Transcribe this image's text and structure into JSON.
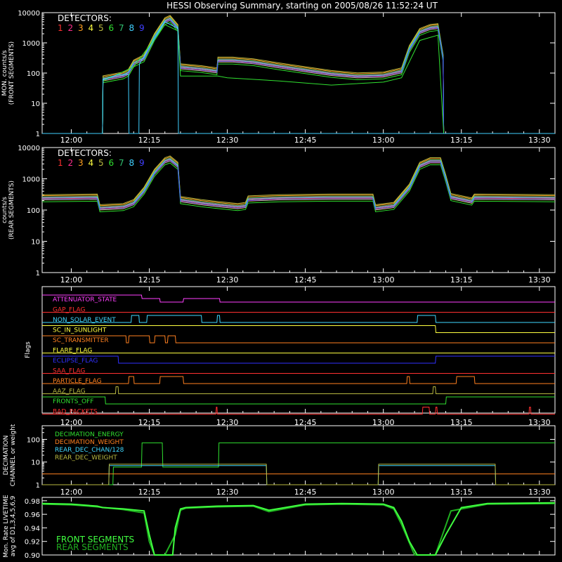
{
  "title": "HESSI Observing Summary, starting on 2005/08/26 11:52:24 UT",
  "colors": {
    "background": "#000000",
    "axes": "#ffffff",
    "detectors": [
      "#ff3030",
      "#ff2d8c",
      "#ffa020",
      "#ffff40",
      "#b8b840",
      "#30e030",
      "#30c070",
      "#40d0ff",
      "#4040ff"
    ]
  },
  "time_axis": {
    "start_minutes": 714.4,
    "end_minutes": 813.0,
    "ticks": [
      {
        "t": 720,
        "label": "12:00"
      },
      {
        "t": 735,
        "label": "12:15"
      },
      {
        "t": 750,
        "label": "12:30"
      },
      {
        "t": 765,
        "label": "12:45"
      },
      {
        "t": 780,
        "label": "13:00"
      },
      {
        "t": 795,
        "label": "13:15"
      },
      {
        "t": 810,
        "label": "13:30"
      }
    ]
  },
  "chart_data": [
    {
      "type": "line",
      "id": "front",
      "ylabel": "MON. counts/s\n(FRONT SEGMENTS)",
      "ylog": true,
      "ylim": [
        1,
        10000
      ],
      "yticks": [
        {
          "v": 1,
          "label": "1"
        },
        {
          "v": 10,
          "label": "10"
        },
        {
          "v": 100,
          "label": "100"
        },
        {
          "v": 1000,
          "label": "1000"
        },
        {
          "v": 10000,
          "label": "10000"
        }
      ],
      "legend_title": "DETECTORS:",
      "legend_labels": [
        "1",
        "2",
        "3",
        "4",
        "5",
        "6",
        "7",
        "8",
        "9"
      ],
      "series": [
        {
          "name": "detectors",
          "x": [
            714.4,
            726.0,
            726.1,
            730.0,
            731.0,
            732.0,
            734.0,
            736.0,
            738.0,
            739.0,
            740.5,
            741.0,
            745.0,
            748.0,
            748.2,
            751.0,
            755.0,
            760.0,
            765.0,
            770.0,
            775.0,
            780.0,
            783.5,
            785.0,
            787.0,
            789.0,
            790.5,
            791.5,
            791.6,
            813.0
          ],
          "y": [
            1,
            1,
            60,
            80,
            100,
            200,
            300,
            1500,
            5000,
            6000,
            3000,
            150,
            130,
            110,
            250,
            250,
            220,
            160,
            120,
            90,
            75,
            80,
            110,
            600,
            2200,
            3000,
            3200,
            300,
            1,
            1
          ]
        },
        {
          "name": "detector 6",
          "x": [
            714.4,
            726.0,
            726.1,
            732.0,
            738.0,
            740.5,
            741.0,
            748.2,
            750.0,
            760.0,
            770.0,
            780.0,
            783.5,
            787.0,
            790.5,
            791.6,
            813.0
          ],
          "y": [
            1,
            1,
            55,
            160,
            4000,
            2500,
            80,
            80,
            70,
            55,
            40,
            50,
            70,
            1200,
            1800,
            1,
            1
          ]
        },
        {
          "name": "detector 8",
          "x": [
            714.4,
            726.0,
            726.1,
            729.0,
            731.0,
            731.1,
            733.0,
            733.1,
            738.0,
            740.5,
            740.6,
            745.0,
            745.1,
            813.0
          ],
          "y": [
            1,
            1,
            60,
            90,
            90,
            1,
            1,
            200,
            5000,
            3000,
            1,
            1,
            1,
            1
          ]
        }
      ]
    },
    {
      "type": "line",
      "id": "rear",
      "ylabel": "counts/s\n(REAR SEGMENTS)",
      "ylog": true,
      "ylim": [
        1,
        10000
      ],
      "yticks": [
        {
          "v": 1,
          "label": "1"
        },
        {
          "v": 10,
          "label": "10"
        },
        {
          "v": 100,
          "label": "100"
        },
        {
          "v": 1000,
          "label": "1000"
        },
        {
          "v": 10000,
          "label": "10000"
        }
      ],
      "legend_title": "DETECTORS:",
      "legend_labels": [
        "1",
        "2",
        "3",
        "4",
        "5",
        "6",
        "7",
        "8",
        "9"
      ],
      "series": [
        {
          "name": "detectors",
          "x": [
            714.4,
            725.0,
            725.5,
            730.0,
            732.0,
            734.0,
            736.0,
            738.0,
            739.0,
            740.5,
            741.0,
            745.0,
            748.0,
            752.0,
            753.5,
            754.0,
            760.0,
            770.0,
            778.0,
            778.5,
            782.0,
            785.0,
            787.0,
            789.0,
            791.0,
            792.0,
            793.0,
            797.0,
            797.5,
            813.0
          ],
          "y": [
            230,
            240,
            110,
            120,
            160,
            400,
            1500,
            3500,
            4000,
            2500,
            200,
            160,
            140,
            120,
            130,
            210,
            230,
            240,
            240,
            110,
            130,
            500,
            2500,
            3500,
            3500,
            1000,
            250,
            180,
            240,
            230
          ]
        }
      ]
    },
    {
      "type": "table",
      "id": "flags",
      "ylabel": "Flags",
      "rows": [
        {
          "label": "ATTENUATOR_STATE",
          "color": "#ff40ff",
          "x": [
            714.4,
            733.5,
            733.6,
            737.0,
            737.1,
            741.5,
            741.6,
            748.5,
            748.6,
            813.0
          ],
          "level": [
            1,
            1,
            0.5,
            0.5,
            0.0,
            0.0,
            0.5,
            0.5,
            0.0,
            0.0
          ]
        },
        {
          "label": "GAP_FLAG",
          "color": "#ff3030",
          "x": [
            714.4,
            813.0
          ],
          "level": [
            0,
            0
          ]
        },
        {
          "label": "NON_SOLAR_EVENT",
          "color": "#40d8ff",
          "x": [
            714.4,
            731.5,
            731.6,
            733.0,
            733.1,
            734.5,
            734.6,
            745.0,
            745.1,
            748.0,
            748.1,
            748.5,
            748.6,
            786.5,
            786.6,
            790.0,
            790.1,
            813.0
          ],
          "level": [
            0,
            0,
            1,
            1,
            0,
            0,
            1,
            1,
            0,
            0,
            1,
            1,
            0,
            0,
            1,
            1,
            0,
            0
          ]
        },
        {
          "label": "SC_IN_SUNLIGHT",
          "color": "#ffff40",
          "x": [
            714.4,
            790.0,
            790.1,
            813.0
          ],
          "level": [
            1,
            1,
            0,
            0
          ]
        },
        {
          "label": "SC_TRANSMITTER",
          "color": "#ff8020",
          "x": [
            714.4,
            730.5,
            730.6,
            731.0,
            731.1,
            735.0,
            735.1,
            736.0,
            736.1,
            738.0,
            738.1,
            738.5,
            738.6,
            740.0,
            740.1,
            747.5,
            747.6,
            813.0
          ],
          "level": [
            1,
            1,
            0,
            0,
            1,
            1,
            0,
            0,
            1,
            1,
            0,
            0,
            1,
            1,
            0,
            0,
            0,
            0
          ]
        },
        {
          "label": "FLARE_FLAG",
          "color": "#ffff40",
          "x": [
            714.4,
            813.0
          ],
          "level": [
            0,
            0
          ]
        },
        {
          "label": "ECLIPSE_FLAG",
          "color": "#3030ff",
          "x": [
            714.4,
            729.0,
            729.1,
            790.0,
            790.1,
            813.0
          ],
          "level": [
            1,
            1,
            0,
            0,
            1,
            1
          ]
        },
        {
          "label": "SAA_FLAG",
          "color": "#ff3030",
          "x": [
            714.4,
            813.0
          ],
          "level": [
            0,
            0
          ]
        },
        {
          "label": "PARTICLE_FLAG",
          "color": "#ff8020",
          "x": [
            714.4,
            731.0,
            731.1,
            732.0,
            732.1,
            737.0,
            737.1,
            741.5,
            741.6,
            784.5,
            784.6,
            785.0,
            785.1,
            794.0,
            794.1,
            797.5,
            797.6,
            798.0,
            798.1,
            813.0
          ],
          "level": [
            0,
            0,
            1,
            1,
            0,
            0,
            1,
            1,
            0,
            0,
            1,
            1,
            0,
            0,
            1,
            1,
            0,
            0,
            0,
            0
          ]
        },
        {
          "label": "AAZ_FLAG",
          "color": "#b8b840",
          "x": [
            714.4,
            728.5,
            728.6,
            729.0,
            729.1,
            789.5,
            789.6,
            790.0,
            790.1,
            813.0
          ],
          "level": [
            0,
            0,
            1,
            1,
            0,
            0,
            1,
            1,
            0,
            0
          ]
        },
        {
          "label": "FRONTS_OFF",
          "color": "#30e030",
          "x": [
            714.4,
            726.5,
            726.6,
            792.0,
            792.1,
            813.0
          ],
          "level": [
            1,
            1,
            0,
            0,
            1,
            1
          ]
        },
        {
          "label": "BAD_PACKETS",
          "color": "#ff3030",
          "x": [
            714.4,
            747.8,
            747.9,
            748.0,
            748.1,
            787.5,
            787.6,
            788.8,
            788.9,
            790.0,
            790.1,
            790.3,
            790.4,
            808.0,
            808.1,
            808.3,
            808.4,
            813.0
          ],
          "level": [
            0,
            0,
            1,
            1,
            0,
            0,
            1,
            1,
            0,
            0,
            1,
            1,
            0,
            0,
            1,
            1,
            0,
            0
          ]
        }
      ]
    },
    {
      "type": "line",
      "id": "decimation",
      "ylabel": "DECIMATION\nCHANNEL or weight",
      "ylog": true,
      "ylim": [
        1,
        400
      ],
      "yticks": [
        {
          "v": 1,
          "label": "1"
        },
        {
          "v": 10,
          "label": "10"
        },
        {
          "v": 100,
          "label": "100"
        }
      ],
      "series": [
        {
          "name": "DECIMATION_ENERGY",
          "color": "#30e030",
          "x": [
            714.4,
            728.0,
            728.1,
            733.5,
            733.6,
            737.5,
            737.6,
            748.3,
            748.4,
            813.0
          ],
          "y": [
            1,
            1,
            6,
            6,
            70,
            70,
            6,
            6,
            70,
            70
          ]
        },
        {
          "name": "DECIMATION_WEIGHT",
          "color": "#ff8020",
          "x": [
            714.4,
            813.0
          ],
          "y": [
            3,
            3
          ]
        },
        {
          "name": "REAR_DEC_CHAN/128",
          "color": "#40d8ff",
          "x": [
            714.4,
            727.2,
            727.3,
            757.5,
            757.6,
            779.0,
            779.1,
            801.5,
            801.6,
            813.0
          ],
          "y": [
            1,
            1,
            7,
            7,
            1,
            1,
            7,
            7,
            1,
            1
          ]
        },
        {
          "name": "REAR_DEC_WEIGHT",
          "color": "#b8b840",
          "x": [
            714.4,
            727.2,
            727.3,
            757.5,
            757.6,
            779.0,
            779.1,
            801.5,
            801.6,
            813.0
          ],
          "y": [
            1,
            1,
            8,
            8,
            1,
            1,
            8,
            8,
            1,
            1
          ]
        }
      ]
    },
    {
      "type": "line",
      "id": "livetime",
      "ylabel": "Mon. Rate LIVETIME\navg of D1,3,4,5,6,9",
      "ylim": [
        0.9,
        0.985
      ],
      "yticks": [
        {
          "v": 0.9,
          "label": "0.90"
        },
        {
          "v": 0.92,
          "label": "0.92"
        },
        {
          "v": 0.94,
          "label": "0.94"
        },
        {
          "v": 0.96,
          "label": "0.96"
        },
        {
          "v": 0.98,
          "label": "0.98"
        }
      ],
      "series": [
        {
          "name": "FRONT SEGMENTS",
          "color": "#40ff40",
          "x": [
            714.4,
            720.0,
            725.0,
            726.0,
            730.0,
            734.0,
            735.0,
            736.0,
            738.0,
            739.5,
            740.0,
            741.0,
            742.0,
            748.0,
            755.0,
            758.0,
            765.0,
            772.0,
            780.0,
            782.0,
            783.5,
            785.0,
            786.5,
            787.0,
            790.0,
            792.0,
            795.0,
            800.0,
            813.0
          ],
          "y": [
            0.976,
            0.975,
            0.972,
            0.97,
            0.968,
            0.965,
            0.93,
            0.9,
            0.9,
            0.9,
            0.94,
            0.968,
            0.97,
            0.972,
            0.973,
            0.966,
            0.975,
            0.976,
            0.975,
            0.97,
            0.95,
            0.92,
            0.9,
            0.9,
            0.9,
            0.93,
            0.97,
            0.976,
            0.977
          ]
        },
        {
          "name": "REAR SEGMENTS",
          "color": "#20b020",
          "x": [
            714.4,
            720.0,
            725.0,
            730.0,
            734.0,
            735.0,
            736.0,
            738.0,
            740.0,
            741.0,
            742.0,
            748.0,
            755.0,
            758.0,
            765.0,
            772.0,
            780.0,
            782.0,
            783.5,
            786.0,
            788.0,
            790.0,
            793.0,
            800.0,
            813.0
          ],
          "y": [
            0.975,
            0.974,
            0.971,
            0.967,
            0.962,
            0.92,
            0.9,
            0.9,
            0.93,
            0.966,
            0.969,
            0.971,
            0.972,
            0.964,
            0.974,
            0.975,
            0.974,
            0.968,
            0.945,
            0.9,
            0.9,
            0.9,
            0.965,
            0.975,
            0.976
          ]
        }
      ]
    }
  ]
}
